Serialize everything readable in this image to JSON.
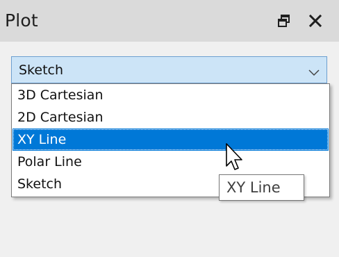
{
  "panel": {
    "title": "Plot",
    "float_icon": "float-restore-icon",
    "close_icon": "close-icon"
  },
  "combo": {
    "value": "Sketch",
    "icon": "chevron-down-icon",
    "options": [
      "3D Cartesian",
      "2D Cartesian",
      "XY Line",
      "Polar Line",
      "Sketch"
    ],
    "highlighted": "XY Line"
  },
  "tooltip": {
    "text": "XY Line"
  },
  "colors": {
    "titlebar": "#dadada",
    "combo_bg": "#cce4f7",
    "selection": "#0078d7"
  }
}
